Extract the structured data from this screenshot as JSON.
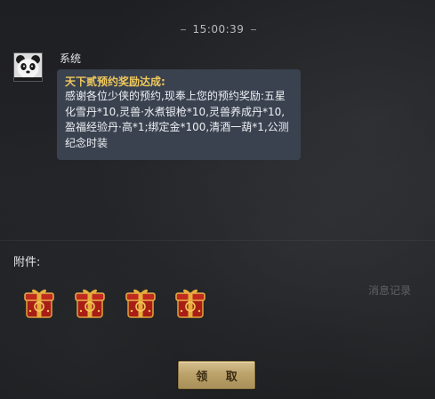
{
  "timestamp": "15:00:39",
  "message": {
    "sender": "系统",
    "title": "天下贰预约奖励达成:",
    "body": "感谢各位少侠的预约,现奉上您的预约奖励:五星化雪丹*10,灵兽·水煮银枪*10,灵兽养成丹*10,盈福经验丹·高*1;绑定金*100,清酒一葫*1,公测纪念时装"
  },
  "attachments": {
    "label": "附件:",
    "items": [
      {
        "icon": "gift-box-icon"
      },
      {
        "icon": "gift-box-icon"
      },
      {
        "icon": "gift-box-icon"
      },
      {
        "icon": "gift-box-icon"
      }
    ]
  },
  "history_link": "消息记录",
  "claim_button": "领 取",
  "colors": {
    "title_gold": "#f0c95c",
    "bubble_bg": "#3a4250",
    "button_gold": "#bca36b",
    "gift_red": "#b3241a"
  }
}
